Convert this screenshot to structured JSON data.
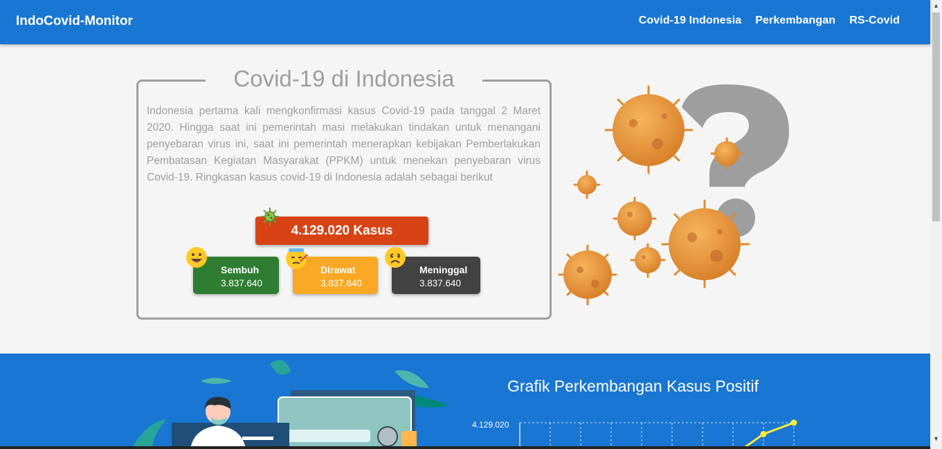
{
  "navbar": {
    "brand": "IndoCovid-Monitor",
    "links": [
      "Covid-19 Indonesia",
      "Perkembangan",
      "RS-Covid"
    ]
  },
  "info": {
    "title": "Covid-19 di Indonesia",
    "text": "Indonesia pertama kali mengkonfirmasi kasus Covid-19 pada tanggal 2 Maret 2020. Hingga saat ini pemerintah masi melakukan tindakan untuk menangani penyebaran virus ini, saat ini pemerintah menerapkan kebijakan Pemberlakukan Pembatasan Kegiatan Masyarakat (PPKM) untuk menekan penyebaran virus Covid-19. Ringkasan kasus covid-19 di Indonesia adalah sebagai berikut"
  },
  "stats": {
    "total": "4.129.020 Kasus",
    "cards": [
      {
        "label": "Sembuh",
        "value": "3.837.640",
        "color": "#2e7d32"
      },
      {
        "label": "Dirawat",
        "value": "3.837.640",
        "color": "#f9a825"
      },
      {
        "label": "Meninggal",
        "value": "3.837.640",
        "color": "#424242"
      }
    ]
  },
  "graph": {
    "title": "Grafik Perkembangan Kasus Positif",
    "y_tick": "4.129.020"
  },
  "chart_data": {
    "type": "line",
    "title": "Grafik Perkembangan Kasus Positif",
    "y_ticks": [
      "4.129.020"
    ],
    "series": [
      {
        "values": [
          null,
          null,
          null,
          null,
          null,
          null,
          null,
          3.9,
          4.05,
          4.129
        ]
      }
    ],
    "grid": true
  },
  "colors": {
    "primary": "#1976d2",
    "total": "#d84315",
    "sembuh": "#2e7d32",
    "dirawat": "#f9a825",
    "meninggal": "#424242"
  },
  "icons": [
    "virus-icon",
    "smile-emoji-icon",
    "sick-emoji-icon",
    "sad-emoji-icon",
    "arrow-up-icon",
    "arrow-down-icon"
  ]
}
